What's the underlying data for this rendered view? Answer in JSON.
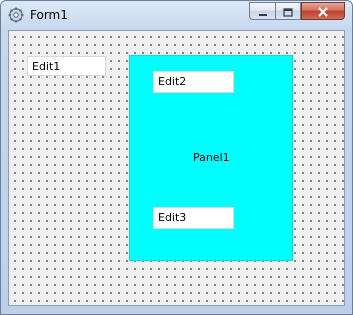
{
  "window": {
    "title": "Form1",
    "icon": "gear-form-icon"
  },
  "controls": {
    "minimize": "minimize-icon",
    "maximize": "maximize-icon",
    "close": "close-icon"
  },
  "form": {
    "edit1": {
      "text": "Edit1"
    },
    "panel": {
      "caption": "Panel1",
      "color": "#00ffff",
      "edit2": {
        "text": "Edit2"
      },
      "edit3": {
        "text": "Edit3"
      }
    }
  }
}
